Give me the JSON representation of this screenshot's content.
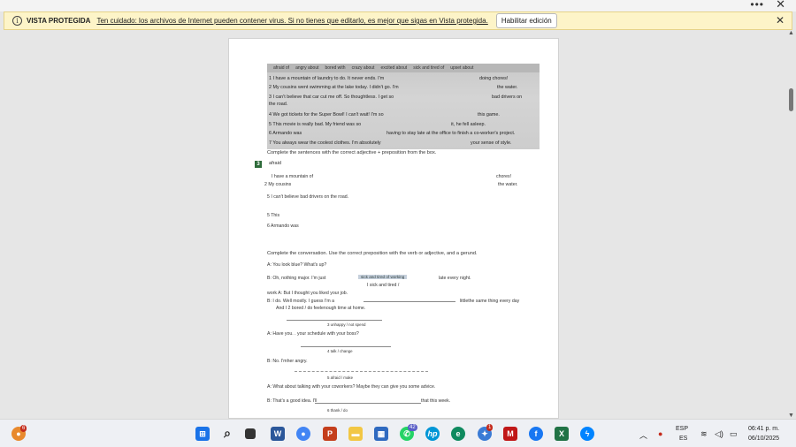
{
  "window": {
    "more_icon": "more-icon",
    "close_icon": "close-icon"
  },
  "protected_view": {
    "title": "VISTA PROTEGIDA",
    "message": "Ten cuidado: los archivos de Internet pueden contener virus. Si no tienes que editarlo, es mejor que sigas en Vista protegida.",
    "button": "Habilitar edición",
    "bar_color": "#fdf4c8"
  },
  "photo": {
    "word_bank": [
      "afraid of",
      "angry about",
      "bored with",
      "crazy about",
      "excited about",
      "sick and tired of",
      "upset about"
    ],
    "lines": [
      {
        "start": "1  I have a mountain of laundry to do. It never ends. I'm",
        "end": "doing chores!"
      },
      {
        "start": "2  My cousins went swimming at the lake today. I didn't go. I'm",
        "end": "the water."
      },
      {
        "start": "3  I can't believe that car cut me off. So thoughtless. I get so",
        "end": "bad drivers on"
      },
      {
        "start": "    the road.",
        "end": ""
      },
      {
        "start": "4  We got tickets for the Super Bowl! I can't wait! I'm so",
        "end": "this game."
      },
      {
        "start": "5  This movie is really bad. My friend was so",
        "end": "it, he fell asleep."
      },
      {
        "start": "6  Armando was",
        "end": "having to stay late at the office to finish a co-worker's project."
      },
      {
        "start": "7  You always wear the coolest clothes. I'm absolutely",
        "end": "your sense of style."
      }
    ]
  },
  "doc": {
    "instr1": "Complete the sentences with the correct adjective + preposition from the box.",
    "ex_num": "3",
    "ex_word": "afraid",
    "s1_start": "I have a mountain of",
    "s1_end": "chores!",
    "s2_start": "2 My cousins",
    "s2_end": "the water.",
    "s3": "5 I can't believe      bad drivers on the road.",
    "s5": "5 This",
    "s6": "6 Armando was",
    "instr2": "Complete the conversation. Use the correct preposition with the verb or adjective, and a gerund.",
    "a1": "A: You look blue? What's up?",
    "b1_start": "B: Oh, nothing major. I'm just",
    "b1_fill": "sick and tired of working",
    "b1_end": "late every night.",
    "b1_hint": "I  sick  and  tired  /",
    "a2": "work A: But I thought you liked your job.",
    "b2_start": "B: I  do.  Well mostly.  I  guess  I'm  a",
    "b2_end": "littlethe same thing every day",
    "b2_cont": "And I 2 bored / do feelenough time at home.",
    "hint3": "3 unhappy / not spend",
    "a3": "A: Have you. . your schedule with your boss?",
    "hint4": "4 talk / change",
    "b3": "B: No. I'mher angry.",
    "hint5": "5 afraid / make",
    "a4": "A: What about talking with your coworkers? Maybe they can give you some advice.",
    "b4_start": "B: That's a good idea. I'll",
    "b4_end": "that this week.",
    "hint6": "6 thank / do"
  },
  "taskbar": {
    "notif_badge": "6",
    "whatsapp_badge": "42",
    "app_badge": "1",
    "lang_top": "ESP",
    "lang_bottom": "ES",
    "time": "06:41 p. m.",
    "date": "06/10/2025",
    "icons": [
      "notification-icon",
      "windows-start-icon",
      "search-icon",
      "task-view-icon",
      "word-icon",
      "chrome-icon",
      "powerpoint-icon",
      "file-explorer-icon",
      "store-icon",
      "whatsapp-icon",
      "hp-icon",
      "edge-icon",
      "copilot-icon",
      "mcafee-icon",
      "facebook-icon",
      "excel-icon",
      "messenger-icon"
    ]
  },
  "colors": {
    "word_blue": "#2b579a",
    "excel_green": "#217346",
    "powerpoint_red": "#c43e1c",
    "chrome": "#4285f4",
    "exercise_green": "#2e6b3a"
  }
}
